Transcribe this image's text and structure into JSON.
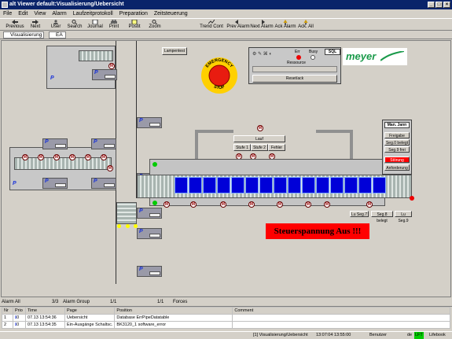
{
  "window": {
    "title": "alt Viewer default:Visualisierung/Uebersicht"
  },
  "menu": [
    "File",
    "Edit",
    "View",
    "Alarm",
    "Laufzeitprotokoll",
    "Preparation",
    "Zeitsteuerung"
  ],
  "toolbar": [
    "Previous",
    "Next",
    "User",
    "Search",
    "Journal",
    "Print",
    "Postit",
    "Zoom",
    "Trend Cont",
    "Prev Alarm",
    "Next Alarm",
    "Ack Alarm",
    "Ack. All"
  ],
  "subbar": {
    "view": "Visualisierung",
    "ea": "EA"
  },
  "hmi": {
    "lampentest": "Lampentest",
    "estop_top": "EMERGENCY",
    "estop_bottom": "STOP",
    "status_err": "Err",
    "status_busy": "Busy",
    "status_id": "SQL",
    "ressource": "Ressource",
    "reset": "Reset/ack",
    "logo": "meyer",
    "lauf": "Lauf",
    "stufe1": "Stufe 1",
    "stufe2": "Stufe 2",
    "fehler": "Fehler",
    "panel_title": "Man. Jann",
    "panel_buttons": [
      "Freigabe",
      "Seg.0 belegt",
      "Seg.9 frei",
      "Störung",
      "Anforderung"
    ],
    "seg_labels": [
      "Lu Seg.7",
      "Seg.8 belegt",
      "Lu Seg.9"
    ],
    "alarm_text": "Steuerspannung Aus !!!",
    "motor_glyph": "M",
    "p_label": "P",
    "colors": {
      "alarm": "#ff0000",
      "workpiece": "#0000d8",
      "estop": "#e81c10",
      "logo_green": "#1a9a4a"
    }
  },
  "bottom": {
    "tabs": [
      {
        "label": "Alarm All",
        "count": "3/3"
      },
      {
        "label": "Alarm Group",
        "count": "1/1"
      },
      {
        "label": "Forces",
        "count": "1/1"
      }
    ],
    "columns": [
      "Nr",
      "Prio",
      "Time",
      "Page",
      "Position",
      "Comment"
    ],
    "rows": [
      [
        "1",
        "0",
        "07.13 13:54:36",
        "Uebersicht",
        "Database ErrPipeDatatable",
        ""
      ],
      [
        "2",
        "0",
        "07.13 13:54:35",
        "Ein-Ausgänge Schaltsc.",
        "BK3120_1 software_error",
        ""
      ]
    ]
  },
  "status": {
    "left": "[1] Visualisierung/Uebersicht",
    "time": "13:07:04 13:55:00",
    "user": "Benutzer",
    "lang": "de",
    "mode": "LFT",
    "host": "Lifebook"
  }
}
